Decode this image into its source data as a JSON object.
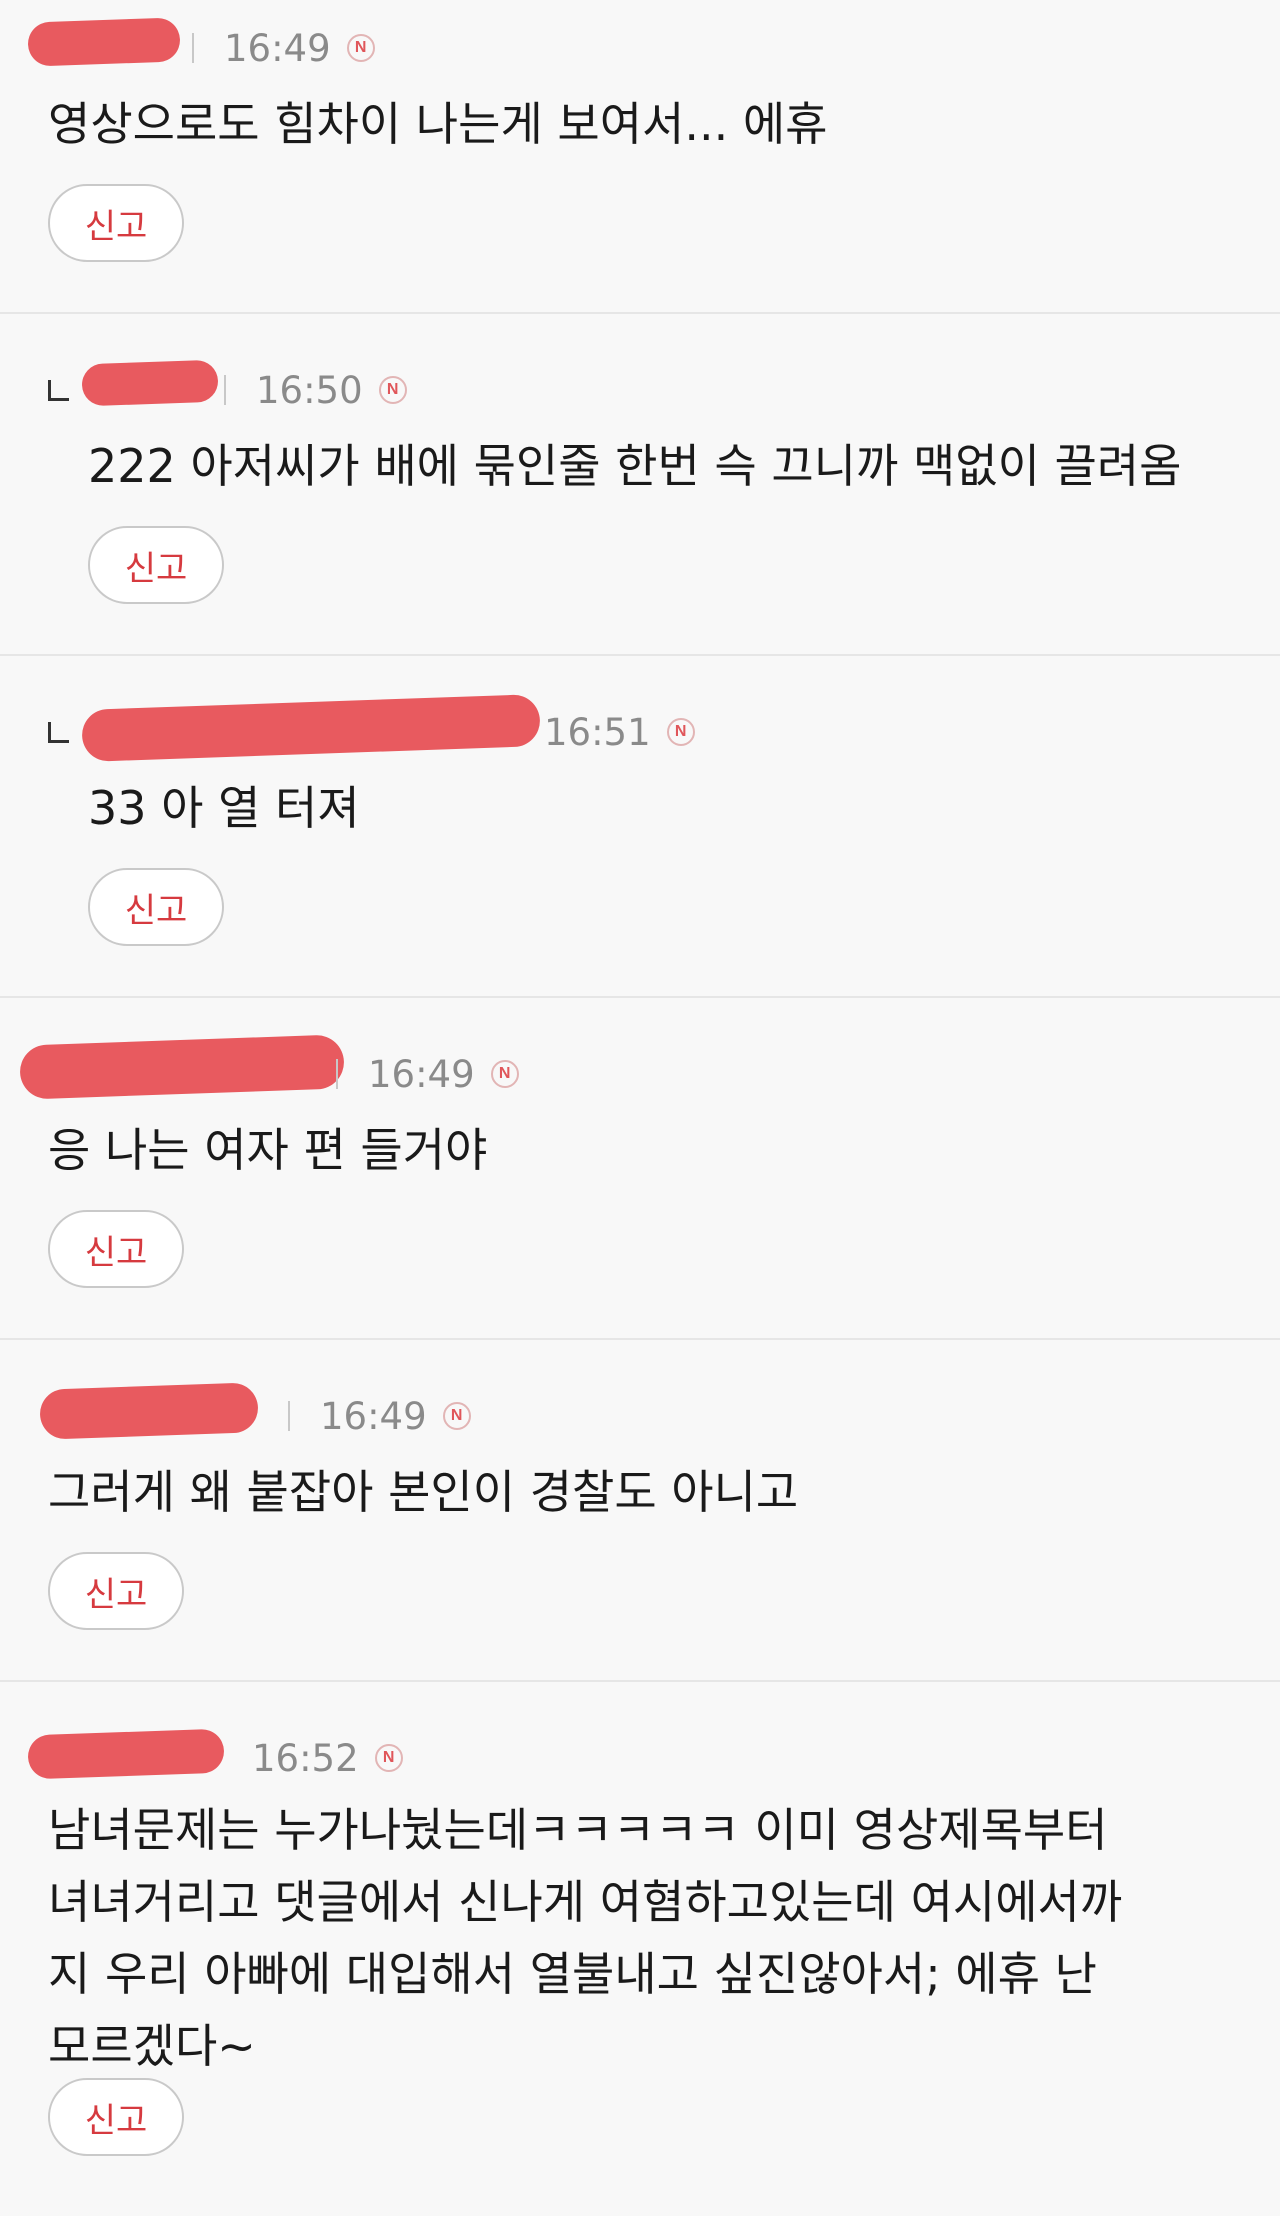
{
  "comments": [
    {
      "time": "16:49",
      "badge": "N",
      "text": "영상으로도 힘차이 나는게 보여서... 에휴",
      "report_label": "신고"
    },
    {
      "time": "16:50",
      "badge": "N",
      "text": "222 아저씨가 배에 묶인줄 한번 슥 끄니까 맥없이 끌려옴",
      "report_label": "신고"
    },
    {
      "time": "16:51",
      "badge": "N",
      "text": "33 아 열 터져",
      "report_label": "신고"
    },
    {
      "time": "16:49",
      "badge": "N",
      "text": "응 나는 여자 편 들거야",
      "report_label": "신고"
    },
    {
      "time": "16:49",
      "badge": "N",
      "text": "그러게 왜 붙잡아 본인이 경찰도 아니고",
      "report_label": "신고"
    },
    {
      "time": "16:52",
      "badge": "N",
      "text": "남녀문제는 누가나눴는데ㅋㅋㅋㅋㅋ 이미 영상제목부터\n녀녀거리고 댓글에서 신나게 여혐하고있는데 여시에서까\n지 우리 아빠에 대입해서 열불내고 싶진않아서; 에휴 난\n모르겠다~",
      "report_label": "신고"
    }
  ],
  "colors": {
    "accent": "#e0565a",
    "redaction": "#e85a5f",
    "divider": "#e6e6e6"
  },
  "icons": {
    "new_badge": "new-badge-icon",
    "reply": "reply-arrow-icon"
  }
}
